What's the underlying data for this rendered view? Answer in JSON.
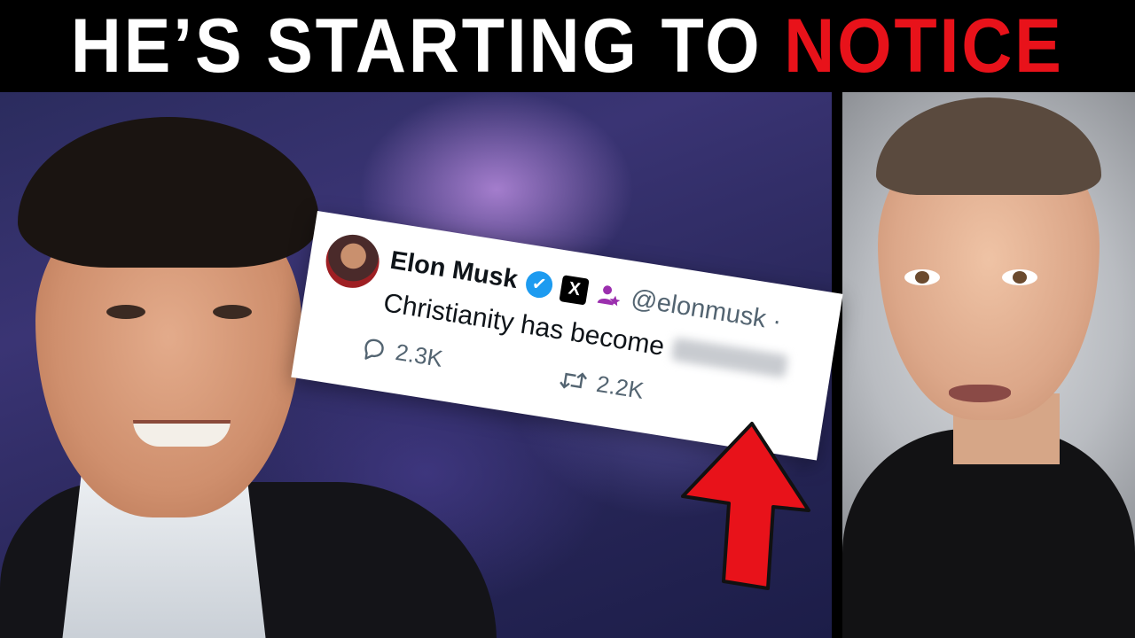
{
  "headline": {
    "part1": "HE’S STARTING TO",
    "part2": "NOTICE",
    "accent_color": "#e8121a"
  },
  "tweet": {
    "author_name": "Elon Musk",
    "handle": "@elonmusk ·",
    "text": "Christianity has become",
    "replies": "2.3K",
    "reposts": "2.2K",
    "icons": [
      "verified-badge-icon",
      "x-logo-icon",
      "affiliate-icon",
      "reply-icon",
      "repost-icon"
    ]
  },
  "arrow": {
    "color": "#e8121a",
    "direction": "up"
  }
}
